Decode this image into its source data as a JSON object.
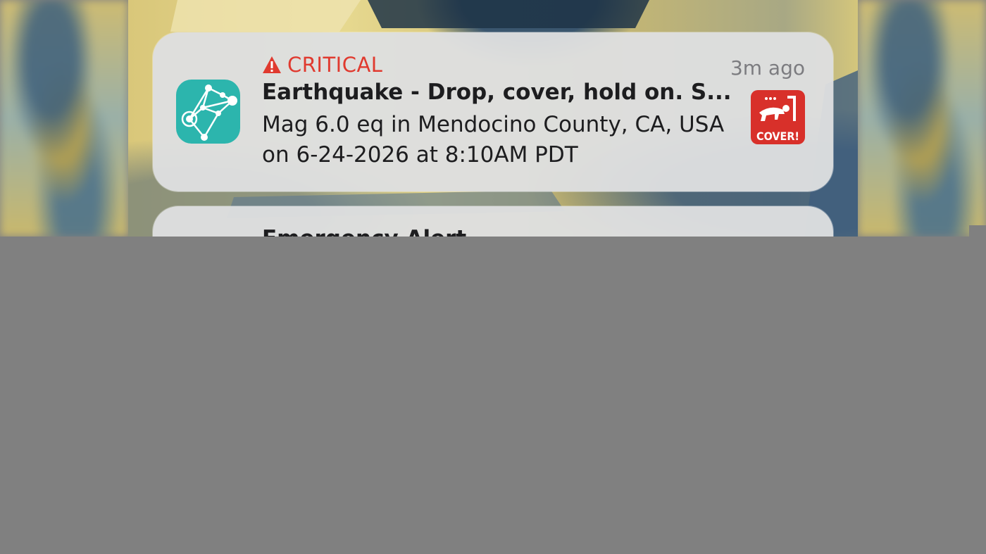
{
  "notification": {
    "level": "CRITICAL",
    "time": "3m ago",
    "title": "Earthquake - Drop, cover, hold on. S...",
    "body": "Mag 6.0 eq in Mendocino County, CA, USA on 6-24-2026 at 8:10AM PDT",
    "app_icon": "network-nodes-icon",
    "thumbnail_label": "COVER!",
    "colors": {
      "critical": "#e03a2f",
      "app_icon_bg": "#2cb5ad",
      "thumbnail_bg": "#d8302a"
    }
  },
  "second_notification": {
    "title": "Emergency Alert"
  }
}
